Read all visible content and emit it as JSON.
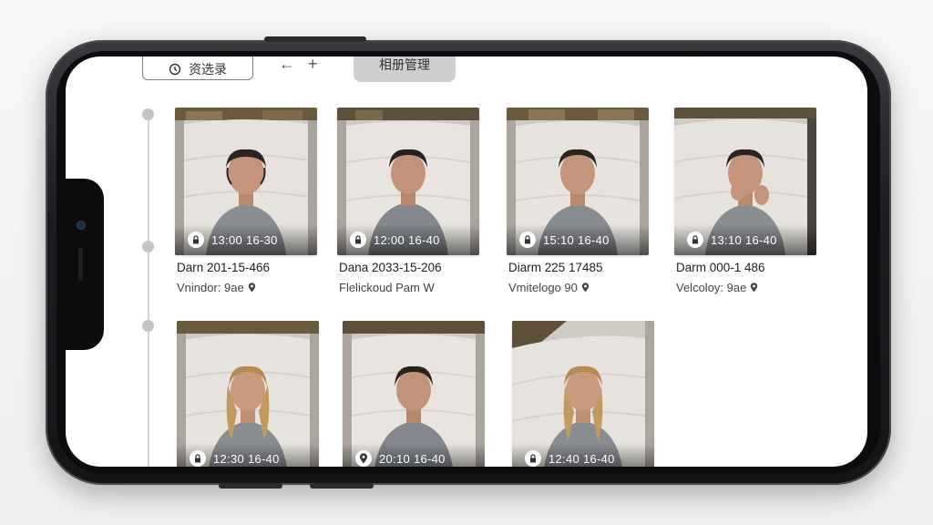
{
  "toolbar": {
    "select_label": "资选录",
    "back_arrow": "←",
    "add_symbol": "+",
    "album_tab_label": "相册管理"
  },
  "row1": [
    {
      "time": "13:00  16-30",
      "title": "Darn 201-15-466",
      "subtitle": "Vnindor: 9ae",
      "badge_icon": "lock-icon"
    },
    {
      "time": "12:00  16-40",
      "title": "Dana 2033-15-206",
      "subtitle": "Flelickoud Pam W",
      "badge_icon": "lock-icon"
    },
    {
      "time": "15:10  16-40",
      "title": "Diarm 225 17485",
      "subtitle": "Vmitelogo 90",
      "badge_icon": "lock-icon"
    },
    {
      "time": "13:10  16-40",
      "title": "Darm 000-1 486",
      "subtitle": "Velcoloy: 9ae",
      "badge_icon": "lock-icon"
    }
  ],
  "row2": [
    {
      "time": "12:30  16-40",
      "badge_icon": "lock-icon"
    },
    {
      "time": "20:10  16-40",
      "badge_icon": "location-icon"
    },
    {
      "time": "12:40  16-40",
      "badge_icon": "lock-icon"
    }
  ],
  "colors": {
    "screen_bg": "#ffffff",
    "phone_frame": "#1c1d20",
    "tab_active_bg": "#cfcfd1",
    "timeline": "#d5d5d7"
  }
}
